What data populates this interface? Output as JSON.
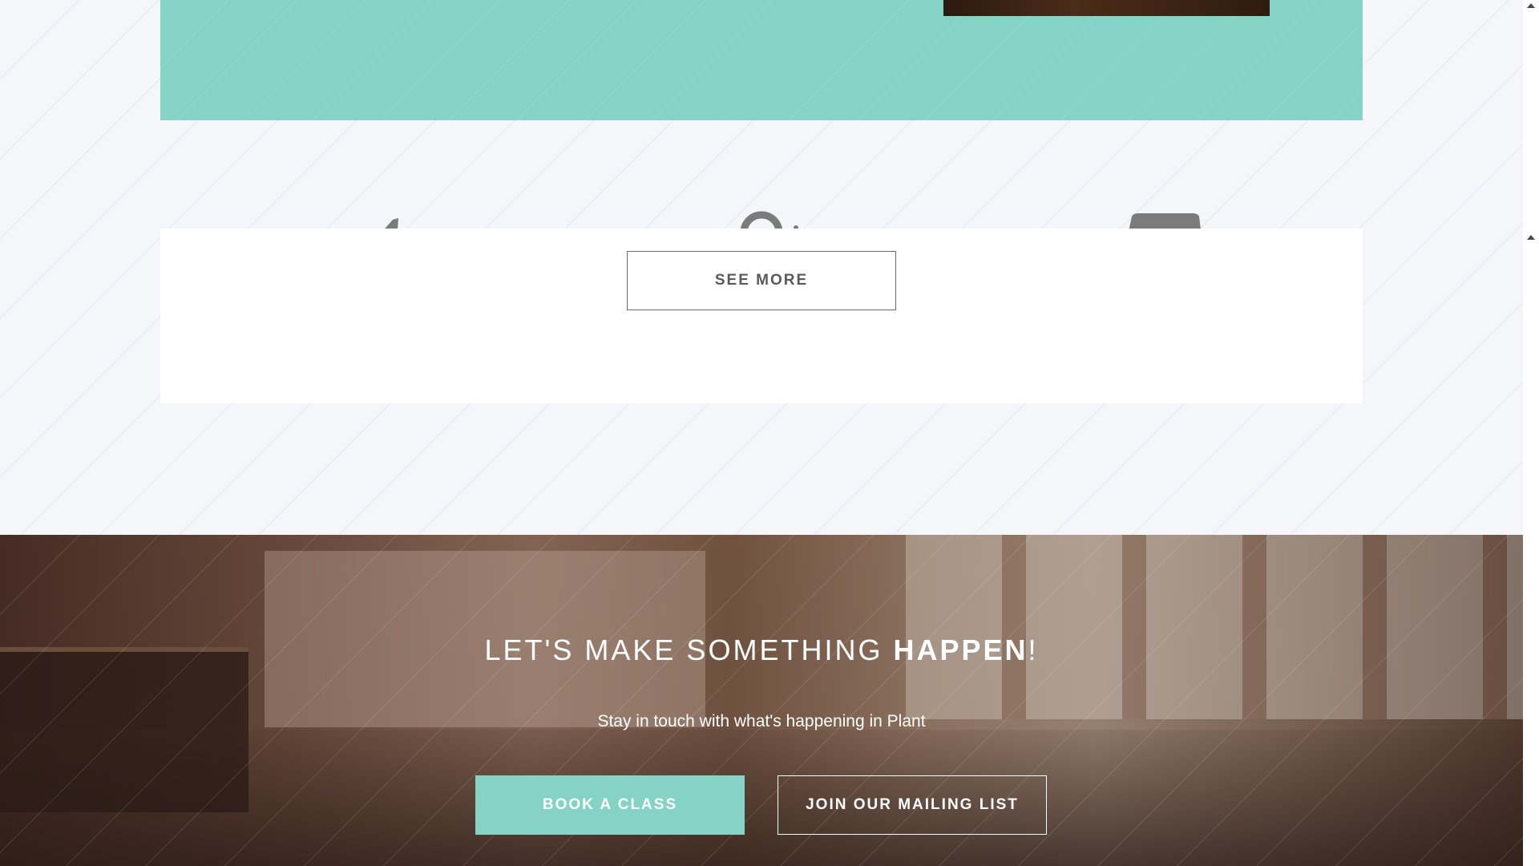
{
  "see_more": {
    "label": "SEE MORE"
  },
  "hero": {
    "title_light": "LET'S MAKE SOMETHING ",
    "title_bold": "HAPPEN",
    "title_end": "!",
    "subtitle": "Stay in touch with what's happening in Plant",
    "book_label": "BOOK A CLASS",
    "mailing_label": "JOIN OUR MAILING LIST"
  },
  "colors": {
    "accent": "#84d3c5",
    "background": "#f4f6fa",
    "card": "#ffffff"
  },
  "icons": [
    "scissors-icon",
    "user-icon",
    "calendar-icon",
    "scroll-up-arrow-icon"
  ]
}
